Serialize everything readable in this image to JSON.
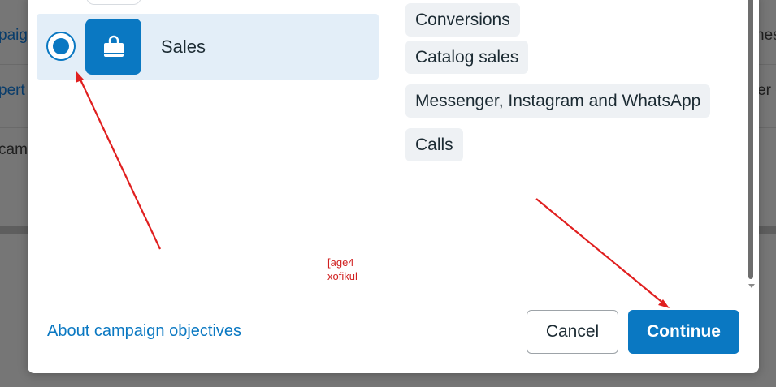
{
  "background": {
    "left_fragments": [
      "paig",
      "pert",
      "cam"
    ],
    "right_fragments": [
      "nes",
      "er c"
    ]
  },
  "objective": {
    "selected_label": "Sales",
    "icon": "shopping-bag-icon"
  },
  "examples": [
    "Conversions",
    "Catalog sales",
    "Messenger, Instagram and WhatsApp",
    "Calls"
  ],
  "annotation": {
    "line1": "[age4",
    "line2": "xofikul"
  },
  "footer": {
    "help_link": "About campaign objectives",
    "cancel_label": "Cancel",
    "continue_label": "Continue"
  },
  "colors": {
    "accent": "#0a78c2",
    "selected_bg": "#e3eef8",
    "arrow": "#e01f1f"
  }
}
